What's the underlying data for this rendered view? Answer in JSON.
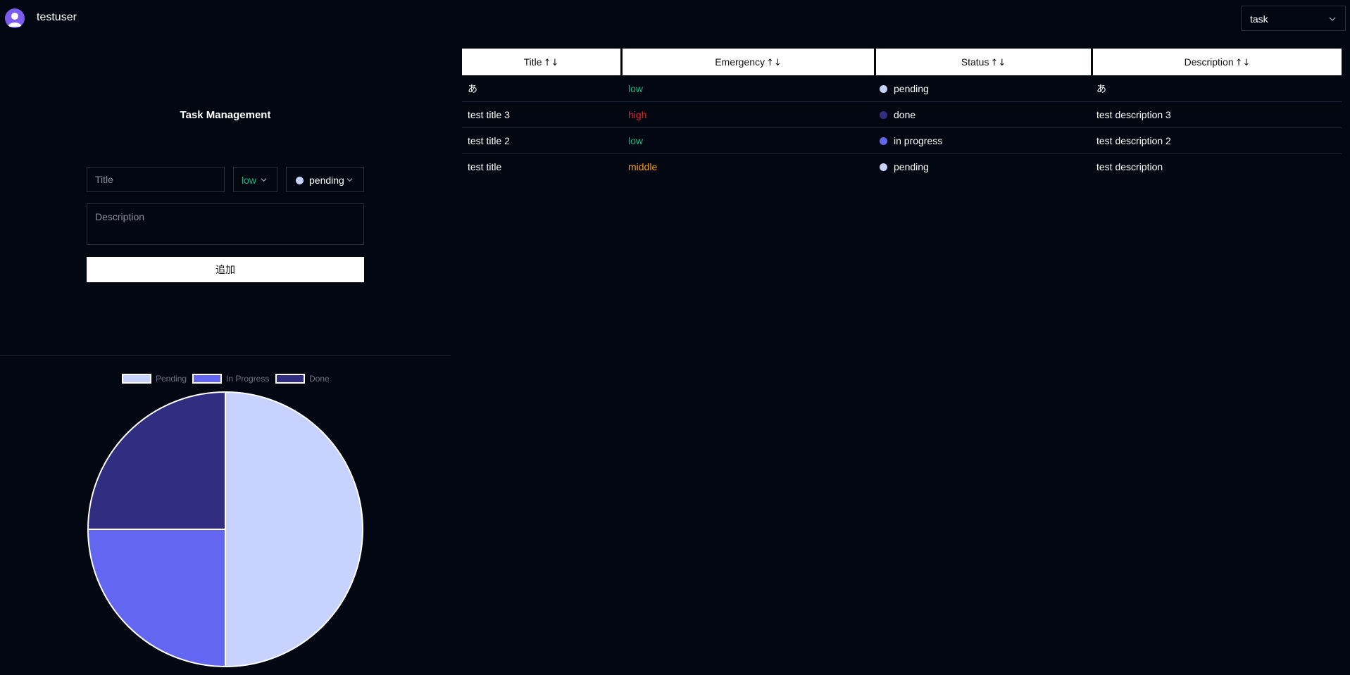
{
  "header": {
    "username": "testuser",
    "view_select": {
      "value": "task"
    }
  },
  "form": {
    "title": "Task Management",
    "title_placeholder": "Title",
    "emergency": {
      "value": "low",
      "color": "#10b981"
    },
    "status": {
      "value": "pending",
      "dot_color": "#c7d2fe"
    },
    "description_placeholder": "Description",
    "add_label": "追加"
  },
  "table": {
    "sort_icon": "↑↓",
    "columns": [
      "Title",
      "Emergency",
      "Status",
      "Description"
    ],
    "rows": [
      {
        "title": "あ",
        "emergency": "low",
        "emergency_color": "#10b981",
        "status": "pending",
        "status_color": "#c7d2fe",
        "description": "あ"
      },
      {
        "title": "test title 3",
        "emergency": "high",
        "emergency_color": "#dc2626",
        "status": "done",
        "status_color": "#312e81",
        "description": "test description 3"
      },
      {
        "title": "test title 2",
        "emergency": "low",
        "emergency_color": "#10b981",
        "status": "in progress",
        "status_color": "#6366f1",
        "description": "test description 2"
      },
      {
        "title": "test title",
        "emergency": "middle",
        "emergency_color": "#f59e0b",
        "status": "pending",
        "status_color": "#c7d2fe",
        "description": "test description"
      }
    ]
  },
  "chart_data": {
    "type": "pie",
    "title": "",
    "legend_position": "top",
    "labels": [
      "Pending",
      "In Progress",
      "Done"
    ],
    "values": [
      2,
      1,
      1
    ],
    "colors": [
      "#c7d2fe",
      "#6366f1",
      "#312e81"
    ]
  }
}
